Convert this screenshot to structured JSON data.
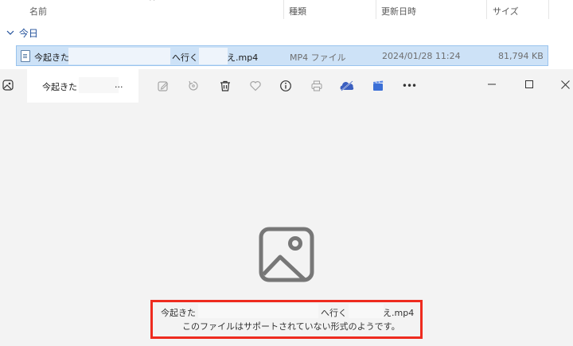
{
  "explorer": {
    "columns": {
      "name": "名前",
      "type": "種類",
      "modified": "更新日時",
      "size": "サイズ"
    },
    "sort_indicator": "^",
    "group_label": "今日",
    "file": {
      "name_start": "今起きた",
      "name_middle": "へ行く",
      "name_end": "え.mp4",
      "type": "MP4 ファイル",
      "modified": "2024/01/28 11:24",
      "size": "81,794 KB"
    }
  },
  "viewer": {
    "title": "今起きた",
    "title_ellipsis": "...",
    "toolbar_icons": [
      "edit-icon",
      "rotate-icon",
      "delete-icon",
      "favorite-icon",
      "info-icon",
      "print-icon",
      "onedrive-icon",
      "clipchamp-icon",
      "more-icon"
    ],
    "more_label": "•••",
    "message": {
      "filename_start": "今起きた",
      "filename_middle": "へ行く",
      "filename_end": "え.mp4",
      "error_text": "このファイルはサポートされていない形式のようです。"
    }
  },
  "colors": {
    "selection": "#cde2f7",
    "accent": "#1f4e99",
    "highlight_border": "#ee2b1f",
    "onedrive": "#3b5fc0",
    "clipchamp": "#3b6fd6"
  }
}
